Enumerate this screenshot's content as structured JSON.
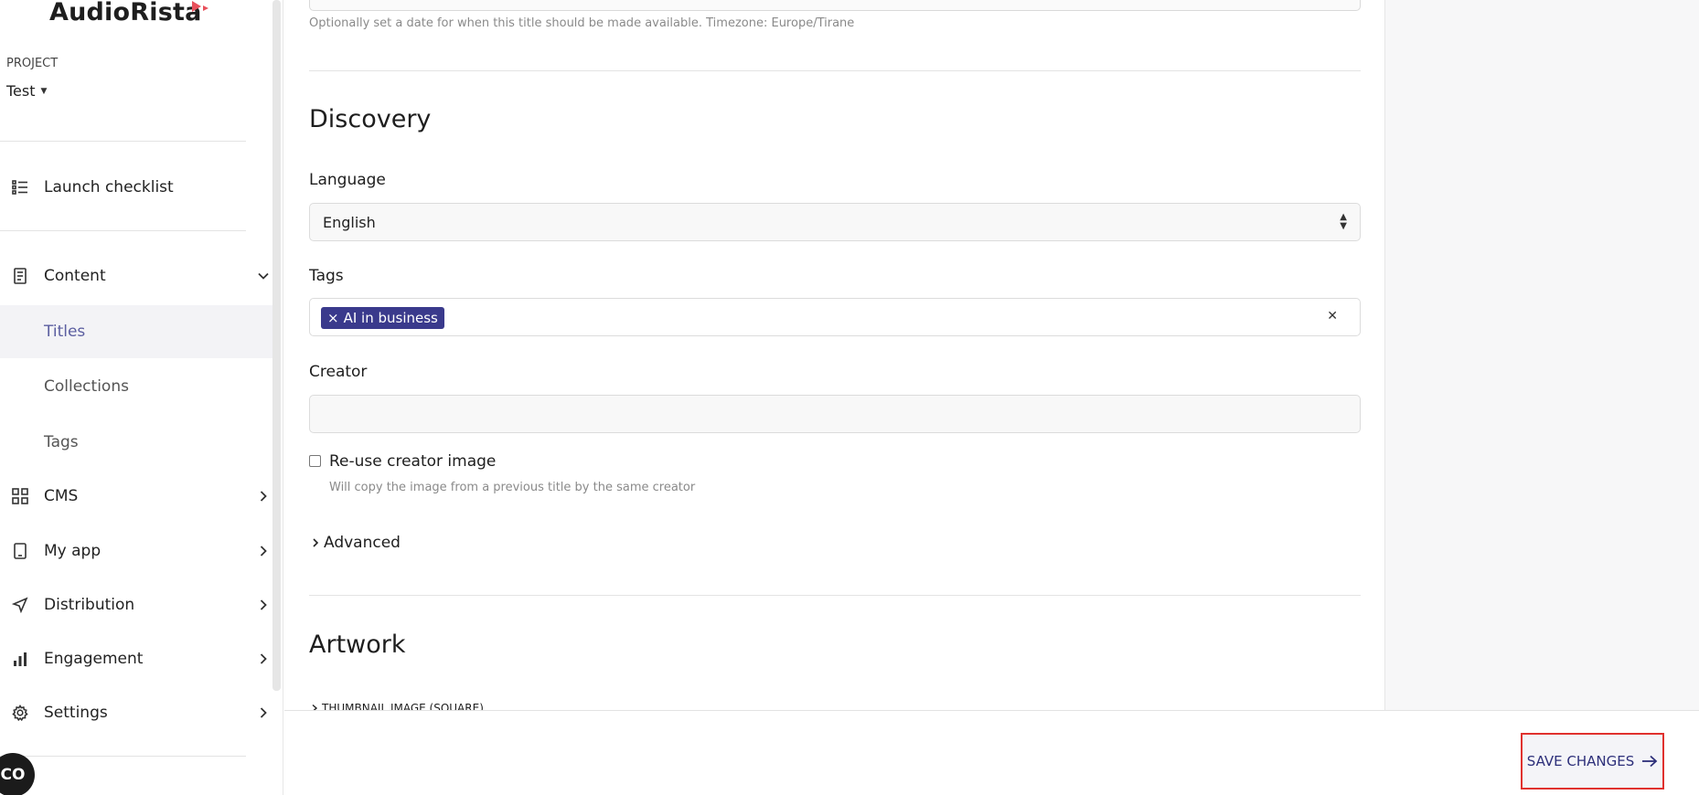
{
  "app": {
    "name": "AudioRista",
    "brand_color": "#e8505b"
  },
  "sidebar": {
    "project_label": "PROJECT",
    "project_value": "Test",
    "launch_checklist": "Launch checklist",
    "content": {
      "label": "Content",
      "children": [
        {
          "label": "Titles",
          "active": true
        },
        {
          "label": "Collections",
          "active": false
        },
        {
          "label": "Tags",
          "active": false
        }
      ]
    },
    "cms": "CMS",
    "my_app": "My app",
    "distribution": "Distribution",
    "engagement": "Engagement",
    "settings": "Settings",
    "chat_bubble_text": "CO"
  },
  "main": {
    "date_hint": "Optionally set a date for when this title should be made available. Timezone: Europe/Tirane",
    "discovery": {
      "heading": "Discovery",
      "language_label": "Language",
      "language_value": "English",
      "tags_label": "Tags",
      "tags": [
        "AI in business"
      ],
      "creator_label": "Creator",
      "creator_value": "",
      "reuse_creator_label": "Re-use creator image",
      "reuse_creator_checked": false,
      "reuse_creator_hint": "Will copy the image from a previous title by the same creator",
      "advanced_label": "Advanced"
    },
    "artwork": {
      "heading": "Artwork",
      "thumbnail_label": "THUMBNAIL IMAGE (SQUARE)"
    }
  },
  "footer": {
    "save_label": "SAVE CHANGES",
    "save_color": "#2d2f7a"
  }
}
